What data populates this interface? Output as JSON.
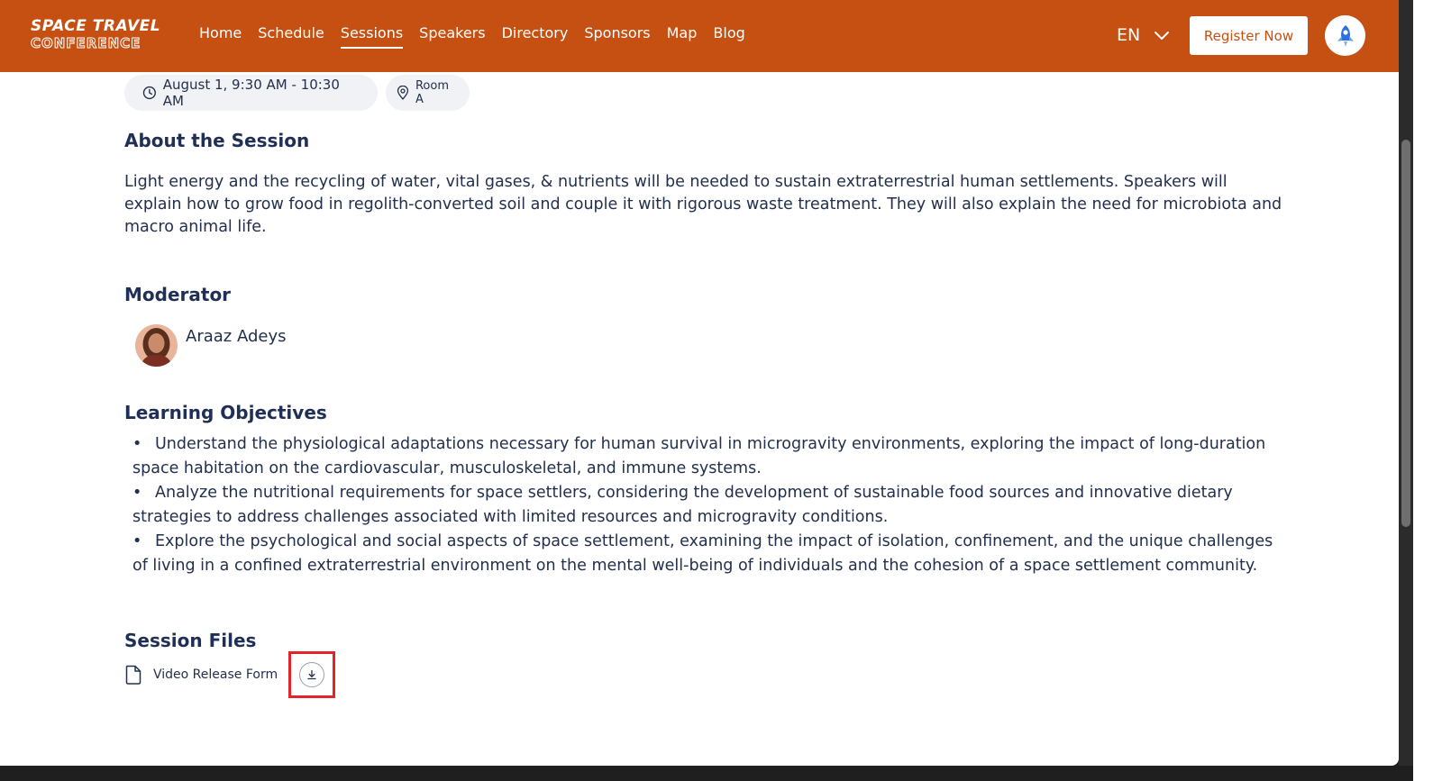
{
  "header": {
    "logo_line1": "Space Travel",
    "logo_line2": "Conference",
    "nav": [
      "Home",
      "Schedule",
      "Sessions",
      "Speakers",
      "Directory",
      "Sponsors",
      "Map",
      "Blog"
    ],
    "active_nav": "Sessions",
    "language": "EN",
    "register_label": "Register Now"
  },
  "session": {
    "time": "August 1, 9:30 AM - 10:30 AM",
    "room": "Room A",
    "about_heading": "About the Session",
    "about_text": "Light energy and the recycling of water, vital gases, & nutrients will be needed to sustain extraterrestrial human settlements. Speakers will explain how to grow food in regolith-converted soil and couple it with rigorous waste treatment. They will also explain the need for microbiota and macro animal life.",
    "moderator_heading": "Moderator",
    "moderator_name": "Araaz Adeys",
    "objectives_heading": "Learning Objectives",
    "objectives": [
      "Understand the physiological adaptations necessary for human survival in microgravity environments, exploring the impact of long-duration space habitation on the cardiovascular, musculoskeletal, and immune systems.",
      "Analyze the nutritional requirements for space settlers, considering the development of sustainable food sources and innovative dietary strategies to address challenges associated with limited resources and microgravity conditions.",
      "Explore the psychological and social aspects of space settlement, examining the impact of isolation, confinement, and the unique challenges of living in a confined extraterrestrial environment on the mental well-being of individuals and the cohesion of a space settlement community."
    ],
    "files_heading": "Session Files",
    "files": [
      {
        "name": "Video Release Form",
        "icon": "document-icon",
        "action_icon": "download-icon"
      }
    ]
  },
  "colors": {
    "header_bg": "#c55012",
    "heading_text": "#1f2f56",
    "body_text": "#22304d",
    "chip_bg": "#f0f2f5",
    "highlight_border": "#e5212a"
  }
}
